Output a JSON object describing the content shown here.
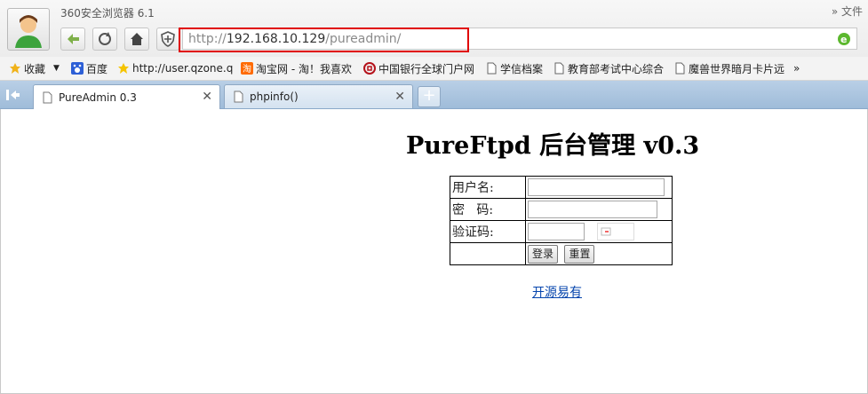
{
  "browser": {
    "app_title": "360安全浏览器 6.1",
    "right_menu": "» 文件",
    "address": {
      "scheme": "http://",
      "host": "192.168.10.129",
      "path": "/pureadmin/"
    }
  },
  "bookmarks": [
    {
      "label": "收藏",
      "icon": "star-folder-icon"
    },
    {
      "label": "百度",
      "icon": "baidu-paw-icon"
    },
    {
      "label": "http://user.qzone.q",
      "icon": "star-icon"
    },
    {
      "label": "淘宝网 - 淘！我喜欢",
      "icon": "taobao-icon"
    },
    {
      "label": "中国银行全球门户网",
      "icon": "bank-of-china-icon"
    },
    {
      "label": "学信档案",
      "icon": "page-icon"
    },
    {
      "label": "教育部考试中心综合",
      "icon": "page-icon"
    },
    {
      "label": "魔兽世界暗月卡片远",
      "icon": "page-icon"
    }
  ],
  "tabs": [
    {
      "label": "PureAdmin 0.3",
      "active": true
    },
    {
      "label": "phpinfo()",
      "active": false
    }
  ],
  "page": {
    "title": "PureFtpd 后台管理  v0.3",
    "form": {
      "username_label": "用户名:",
      "password_label": "密   码:",
      "captcha_label": "验证码:",
      "login_button": "登录",
      "reset_button": "重置"
    },
    "footer_link": "开源易有"
  },
  "colors": {
    "highlight_box": "#e00000",
    "link": "#0645ad",
    "tabstrip": "#a9c4df"
  }
}
